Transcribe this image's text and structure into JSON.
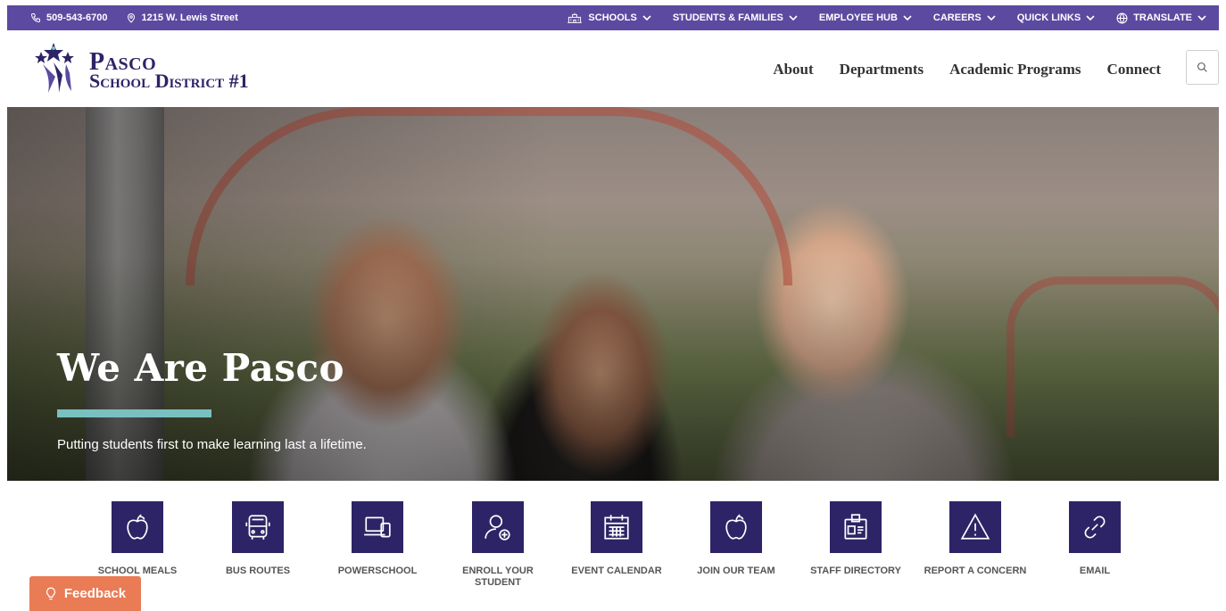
{
  "topbar": {
    "phone": "509-543-6700",
    "address": "1215 W. Lewis Street",
    "nav": [
      {
        "label": "SCHOOLS",
        "icon": "school-icon"
      },
      {
        "label": "STUDENTS & FAMILIES"
      },
      {
        "label": "EMPLOYEE HUB"
      },
      {
        "label": "CAREERS"
      },
      {
        "label": "QUICK LINKS"
      },
      {
        "label": "TRANSLATE",
        "icon": "globe-icon"
      }
    ],
    "bg_color": "#5b4aa0"
  },
  "header": {
    "logo_line1": "Pasco",
    "logo_line2": "School District #1",
    "nav": [
      "About",
      "Departments",
      "Academic Programs",
      "Connect"
    ]
  },
  "hero": {
    "title": "We Are Pasco",
    "tagline": "Putting students first to make learning last a lifetime.",
    "accent_color": "#79c0c0"
  },
  "quick_links": [
    {
      "label": "SCHOOL MEALS",
      "icon": "apple-icon"
    },
    {
      "label": "BUS ROUTES",
      "icon": "bus-icon"
    },
    {
      "label": "POWERSCHOOL",
      "icon": "computer-icon"
    },
    {
      "label": "ENROLL YOUR STUDENT",
      "icon": "user-add-icon"
    },
    {
      "label": "EVENT CALENDAR",
      "icon": "calendar-icon"
    },
    {
      "label": "JOIN OUR TEAM",
      "icon": "apple-icon"
    },
    {
      "label": "STAFF DIRECTORY",
      "icon": "id-badge-icon"
    },
    {
      "label": "REPORT A CONCERN",
      "icon": "warning-icon"
    },
    {
      "label": "EMAIL",
      "icon": "link-icon"
    }
  ],
  "feedback": {
    "label": "Feedback",
    "color": "#e97b55"
  },
  "brand_color": "#2c2466"
}
